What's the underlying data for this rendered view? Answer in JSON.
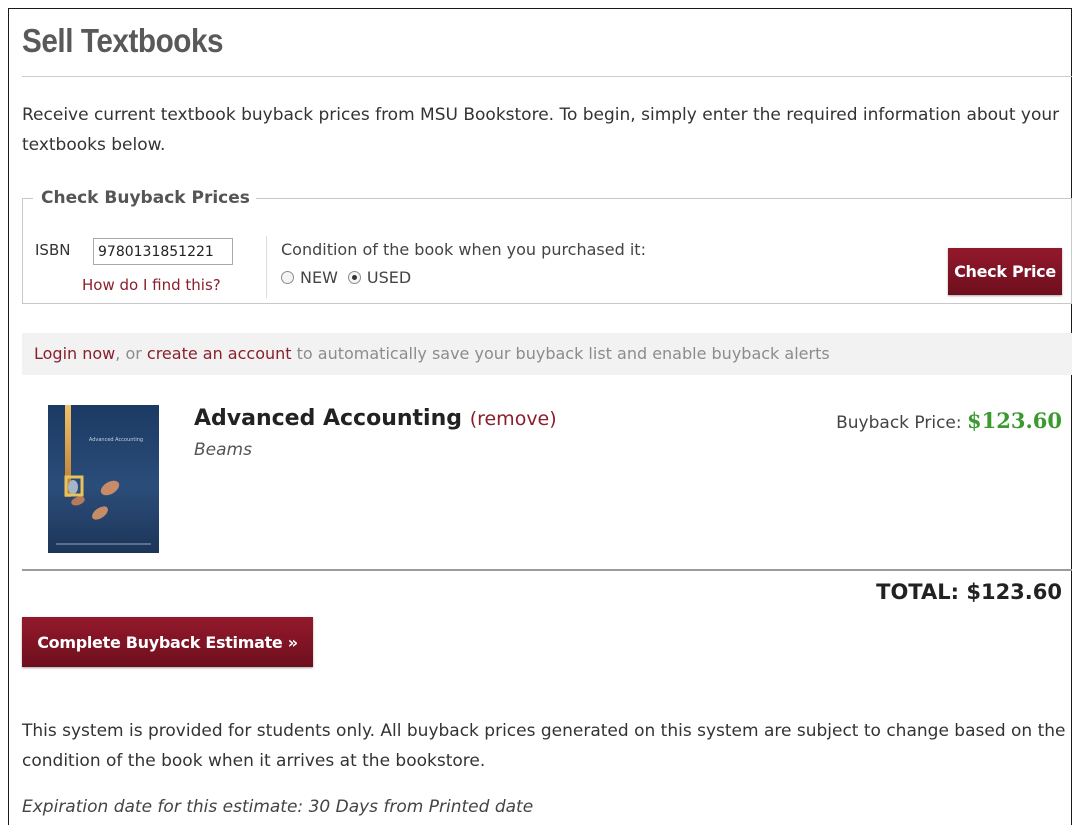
{
  "page": {
    "title": "Sell Textbooks",
    "intro": "Receive current textbook buyback prices from MSU Bookstore. To begin, simply enter the required information about your textbooks below."
  },
  "check_form": {
    "legend": "Check Buyback Prices",
    "isbn_label": "ISBN",
    "isbn_value": "9780131851221",
    "find_link": "How do I find this?",
    "condition_label": "Condition of the book when you purchased it:",
    "options": [
      {
        "label": "NEW",
        "checked": false
      },
      {
        "label": "USED",
        "checked": true
      }
    ],
    "check_button": "Check Price"
  },
  "login_bar": {
    "login_link": "Login now",
    "text_1": ", or ",
    "create_link": "create an account",
    "text_2": " to automatically save your buyback list and enable buyback alerts"
  },
  "book": {
    "title": "Advanced Accounting",
    "remove_link": "(remove)",
    "author": "Beams",
    "price_label": "Buyback Price: ",
    "price": "$123.60",
    "cover_title": "Advanced Accounting"
  },
  "summary": {
    "total": "TOTAL: $123.60",
    "complete_button": "Complete Buyback Estimate »"
  },
  "footer": {
    "disclaimer": "This system is provided for students only. All buyback prices generated on this system are subject to change based on the condition of the book when it arrives at the bookstore.",
    "expiration": "Expiration date for this estimate: 30 Days from Printed date"
  },
  "colors": {
    "brand_maroon": "#7e1424",
    "link_maroon": "#8a1f2c",
    "price_green": "#3a9a2e",
    "title_gray": "#595959"
  }
}
